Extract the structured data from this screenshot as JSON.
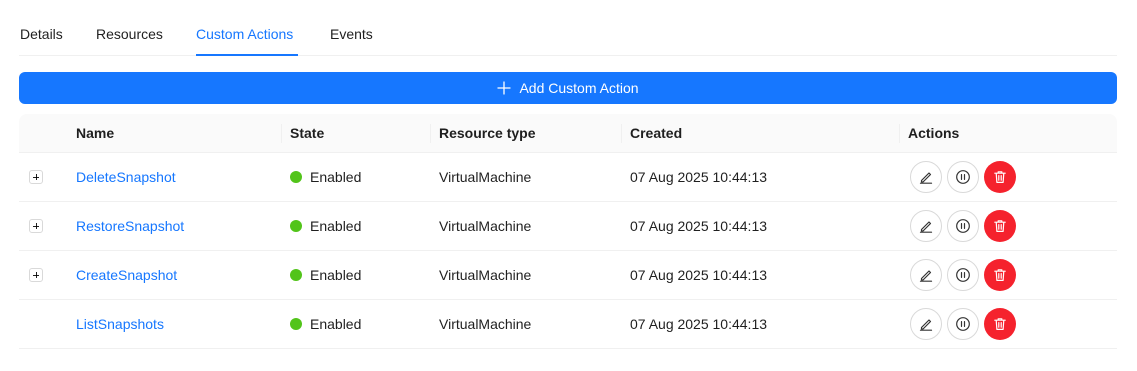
{
  "tabs": [
    {
      "label": "Details",
      "active": false
    },
    {
      "label": "Resources",
      "active": false
    },
    {
      "label": "Custom Actions",
      "active": true
    },
    {
      "label": "Events",
      "active": false
    }
  ],
  "add_button": {
    "label": "Add Custom Action",
    "icon": "plus-icon"
  },
  "table": {
    "columns": [
      "Name",
      "State",
      "Resource type",
      "Created",
      "Actions"
    ],
    "rows": [
      {
        "name": "DeleteSnapshot",
        "state": "Enabled",
        "resource_type": "VirtualMachine",
        "created": "07 Aug 2025 10:44:13",
        "expandable": true
      },
      {
        "name": "RestoreSnapshot",
        "state": "Enabled",
        "resource_type": "VirtualMachine",
        "created": "07 Aug 2025 10:44:13",
        "expandable": true
      },
      {
        "name": "CreateSnapshot",
        "state": "Enabled",
        "resource_type": "VirtualMachine",
        "created": "07 Aug 2025 10:44:13",
        "expandable": true
      },
      {
        "name": "ListSnapshots",
        "state": "Enabled",
        "resource_type": "VirtualMachine",
        "created": "07 Aug 2025 10:44:13",
        "expandable": false
      }
    ],
    "row_actions": [
      "edit-icon",
      "pause-icon",
      "delete-icon"
    ]
  },
  "colors": {
    "primary": "#1677ff",
    "success": "#52c41a",
    "danger": "#f5222d"
  }
}
